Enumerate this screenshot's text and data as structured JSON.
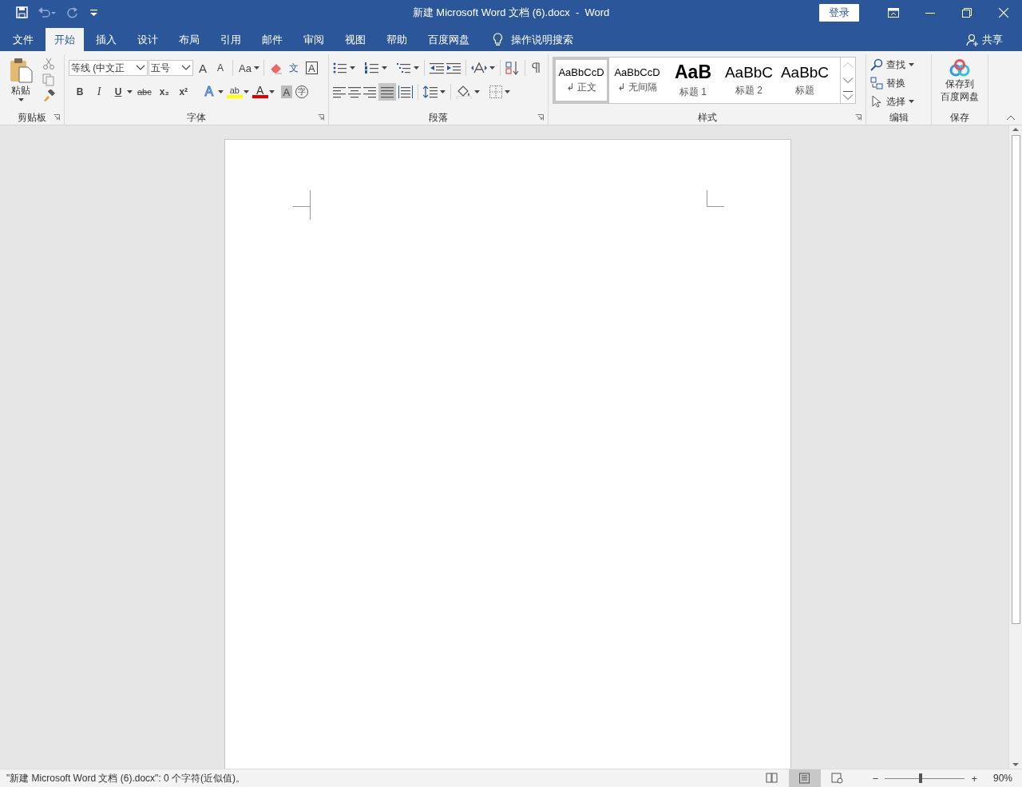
{
  "window": {
    "title": "新建 Microsoft Word 文档 (6).docx  -  Word",
    "sign_in": "登录"
  },
  "tabs": [
    {
      "label": "文件",
      "selected": false
    },
    {
      "label": "开始",
      "selected": true
    },
    {
      "label": "插入",
      "selected": false
    },
    {
      "label": "设计",
      "selected": false
    },
    {
      "label": "布局",
      "selected": false
    },
    {
      "label": "引用",
      "selected": false
    },
    {
      "label": "邮件",
      "selected": false
    },
    {
      "label": "审阅",
      "selected": false
    },
    {
      "label": "视图",
      "selected": false
    },
    {
      "label": "帮助",
      "selected": false
    },
    {
      "label": "百度网盘",
      "selected": false
    }
  ],
  "tell_me": "操作说明搜索",
  "share": "共享",
  "ribbon": {
    "clipboard": {
      "paste": "粘贴",
      "label": "剪贴板"
    },
    "font": {
      "font_name": "等线 (中文正",
      "font_size": "五号",
      "label": "字体",
      "row1": [
        {
          "kind": "grow",
          "glyph": "A"
        },
        {
          "kind": "shrink",
          "glyph": "A"
        },
        {
          "kind": "case",
          "glyph": "Aa"
        },
        {
          "kind": "clear"
        },
        {
          "kind": "pinyin",
          "glyph": "文"
        },
        {
          "kind": "border",
          "glyph": "A"
        }
      ],
      "row2": [
        {
          "kind": "bold",
          "glyph": "B"
        },
        {
          "kind": "italic",
          "glyph": "I"
        },
        {
          "kind": "underline",
          "glyph": "U"
        },
        {
          "kind": "strike",
          "glyph": "abc"
        },
        {
          "kind": "sub",
          "glyph": "x₂"
        },
        {
          "kind": "sup",
          "glyph": "x²"
        },
        {
          "kind": "effect",
          "glyph": "A"
        },
        {
          "kind": "highlight",
          "glyph": "ab"
        },
        {
          "kind": "color",
          "glyph": "A"
        },
        {
          "kind": "shading",
          "glyph": "A"
        },
        {
          "kind": "enclose",
          "glyph": "字"
        }
      ]
    },
    "paragraph": {
      "label": "段落"
    },
    "styles": {
      "label": "样式",
      "items": [
        {
          "preview": "AaBbCcD",
          "name": "↲ 正文",
          "kind": "normal",
          "selected": true
        },
        {
          "preview": "AaBbCcD",
          "name": "↲ 无间隔",
          "kind": "normal",
          "selected": false
        },
        {
          "preview": "AaB",
          "name": "标题 1",
          "kind": "heading1",
          "selected": false
        },
        {
          "preview": "AaBbC",
          "name": "标题 2",
          "kind": "heading2",
          "selected": false
        },
        {
          "preview": "AaBbC",
          "name": "标题",
          "kind": "title",
          "selected": false
        }
      ]
    },
    "editing": {
      "label": "编辑",
      "items": [
        {
          "kind": "find",
          "label": "查找"
        },
        {
          "kind": "replace",
          "label": "替换"
        },
        {
          "kind": "select",
          "label": "选择"
        }
      ]
    },
    "save": {
      "line1": "保存到",
      "line2": "百度网盘",
      "label": "保存"
    }
  },
  "status_bar": {
    "text": "\"新建 Microsoft Word 文档 (6).docx\": 0 个字符(近似值)。",
    "views": [
      {
        "kind": "read",
        "selected": false
      },
      {
        "kind": "print",
        "selected": true
      },
      {
        "kind": "web",
        "selected": false
      }
    ],
    "zoom_out": "−",
    "zoom_in": "+",
    "zoom_slider": {
      "level": 0.45
    },
    "zoom": "90%"
  }
}
